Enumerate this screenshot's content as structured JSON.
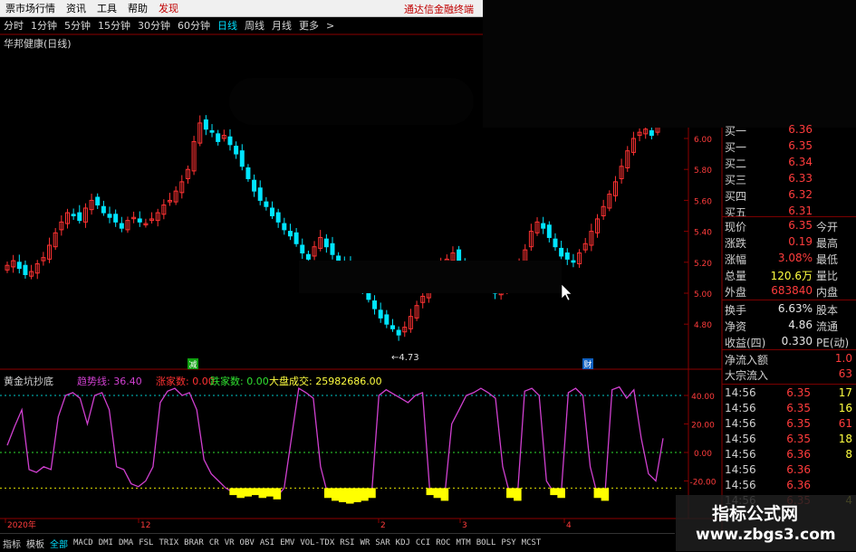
{
  "menu": [
    {
      "label": "票市场行情",
      "red": false
    },
    {
      "label": "资讯",
      "red": false
    },
    {
      "label": "工具",
      "red": false
    },
    {
      "label": "帮助",
      "red": false
    },
    {
      "label": "发现",
      "red": true
    }
  ],
  "brand": "通达信金融终端",
  "periods": [
    {
      "label": "分时",
      "active": false
    },
    {
      "label": "1分钟",
      "active": false
    },
    {
      "label": "5分钟",
      "active": false
    },
    {
      "label": "15分钟",
      "active": false
    },
    {
      "label": "30分钟",
      "active": false
    },
    {
      "label": "60分钟",
      "active": false
    },
    {
      "label": "日线",
      "active": true
    },
    {
      "label": "周线",
      "active": false
    },
    {
      "label": "月线",
      "active": false
    },
    {
      "label": "更多",
      "active": false
    }
  ],
  "periods_more_arrow": ">",
  "stock_name": "华邦健康(日线)",
  "price_axis": [
    "6.00",
    "5.80",
    "5.60",
    "5.40",
    "5.20",
    "5.00",
    "4.80"
  ],
  "low_marker": "←4.73",
  "event_badges": [
    "减",
    "财"
  ],
  "indicator": {
    "name": "黄金坑抄底",
    "trend_label": "趋势线: 36.40",
    "zhangjia_label": "涨家数: 0.00",
    "diejia_label": "跌家数: 0.00",
    "dapan_label": "大盘成交: 25982686.00",
    "axis": [
      "40.00",
      "20.00",
      "0.00",
      "-20.00"
    ]
  },
  "date_axis": [
    "2020年",
    "12",
    "2",
    "3",
    "4"
  ],
  "quotes": {
    "buy": [
      {
        "label": "买一",
        "price": "6.35"
      },
      {
        "label": "买二",
        "price": "6.34"
      },
      {
        "label": "买三",
        "price": "6.33"
      },
      {
        "label": "买四",
        "price": "6.32"
      },
      {
        "label": "买五",
        "price": "6.31"
      }
    ],
    "sell_partial": {
      "label": "买一",
      "price": "6.36"
    },
    "stats": [
      {
        "l": "现价",
        "v": "6.35",
        "e": "今开",
        "vc": "red"
      },
      {
        "l": "涨跌",
        "v": "0.19",
        "e": "最高",
        "vc": "red"
      },
      {
        "l": "涨幅",
        "v": "3.08%",
        "e": "最低",
        "vc": "red"
      },
      {
        "l": "总量",
        "v": "120.6万",
        "e": "量比",
        "vc": "yel"
      },
      {
        "l": "外盘",
        "v": "683840",
        "e": "内盘",
        "vc": "red"
      }
    ],
    "stats2": [
      {
        "l": "换手",
        "v": "6.63%",
        "e": "股本",
        "vc": "wht"
      },
      {
        "l": "净资",
        "v": "4.86",
        "e": "流通",
        "vc": "wht"
      },
      {
        "l": "收益(四)",
        "v": "0.330",
        "e": "PE(动)",
        "vc": "wht"
      }
    ],
    "flow": [
      {
        "l": "净流入额",
        "v": "1.0"
      },
      {
        "l": "大宗流入",
        "v": "63"
      }
    ],
    "ticks": [
      {
        "t": "14:56",
        "p": "6.35",
        "q": "17",
        "qc": "yel"
      },
      {
        "t": "14:56",
        "p": "6.35",
        "q": "16",
        "qc": "yel"
      },
      {
        "t": "14:56",
        "p": "6.35",
        "q": "61",
        "qc": "red"
      },
      {
        "t": "14:56",
        "p": "6.35",
        "q": "18",
        "qc": "yel"
      },
      {
        "t": "14:56",
        "p": "6.36",
        "q": "8",
        "qc": "yel"
      },
      {
        "t": "14:56",
        "p": "6.36",
        "q": "",
        "qc": "yel"
      },
      {
        "t": "14:56",
        "p": "6.36",
        "q": "",
        "qc": "yel"
      },
      {
        "t": "14:56",
        "p": "6.35",
        "q": "4",
        "qc": "yel"
      }
    ]
  },
  "bottom_tabs": [
    {
      "label": "指标",
      "active": false
    },
    {
      "label": "模板",
      "active": false
    },
    {
      "label": "全部",
      "active": true
    },
    {
      "label": "MACD",
      "active": false
    },
    {
      "label": "DMI",
      "active": false
    },
    {
      "label": "DMA",
      "active": false
    },
    {
      "label": "FSL",
      "active": false
    },
    {
      "label": "TRIX",
      "active": false
    },
    {
      "label": "BRAR",
      "active": false
    },
    {
      "label": "CR",
      "active": false
    },
    {
      "label": "VR",
      "active": false
    },
    {
      "label": "OBV",
      "active": false
    },
    {
      "label": "ASI",
      "active": false
    },
    {
      "label": "EMV",
      "active": false
    },
    {
      "label": "VOL-TDX",
      "active": false
    },
    {
      "label": "RSI",
      "active": false
    },
    {
      "label": "WR",
      "active": false
    },
    {
      "label": "SAR",
      "active": false
    },
    {
      "label": "KDJ",
      "active": false
    },
    {
      "label": "CCI",
      "active": false
    },
    {
      "label": "ROC",
      "active": false
    },
    {
      "label": "MTM",
      "active": false
    },
    {
      "label": "BOLL",
      "active": false
    },
    {
      "label": "PSY",
      "active": false
    },
    {
      "label": "MCST",
      "active": false
    }
  ],
  "watermark": {
    "line1": "指标公式网",
    "line2": "www.zbgs3.com"
  },
  "colors": {
    "up": "#ff3232",
    "down": "#00e5ff",
    "trend": "#d040d0",
    "fill": "#ffff00"
  }
}
